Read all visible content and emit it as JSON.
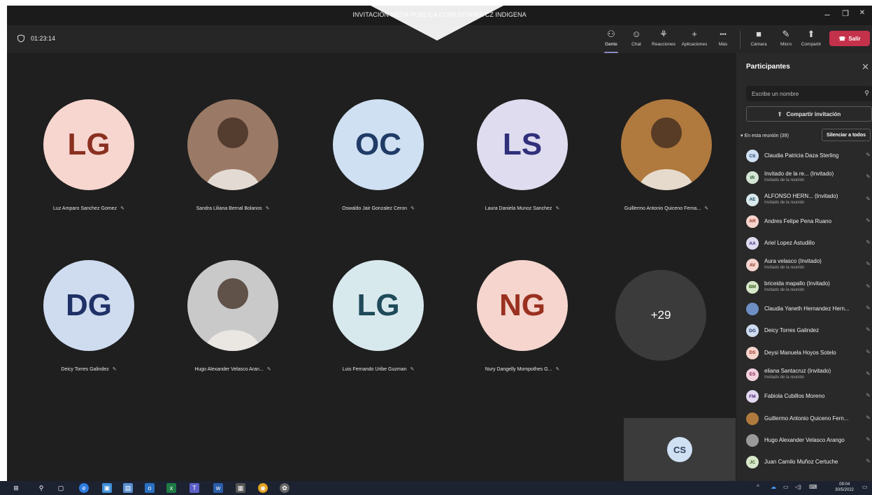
{
  "window": {
    "title": "INVITACIÓN MESA PUBLICA COMUNITARIA CZ INDIGENA",
    "minimize": "–",
    "maximize": "❐",
    "close": "✕"
  },
  "toolbar": {
    "timer": "01:23:14",
    "buttons": [
      {
        "label": "Gente",
        "icon": "people-icon",
        "glyph": "⚇"
      },
      {
        "label": "Chat",
        "icon": "chat-icon",
        "glyph": "☺"
      },
      {
        "label": "Reacciones",
        "icon": "reactions-icon",
        "glyph": "⚘"
      },
      {
        "label": "Aplicaciones",
        "icon": "apps-icon",
        "glyph": "+"
      },
      {
        "label": "Más",
        "icon": "more-icon",
        "glyph": "•••"
      },
      {
        "label": "Cámara",
        "icon": "camera-off-icon",
        "glyph": "■"
      },
      {
        "label": "Micro",
        "icon": "mic-off-icon",
        "glyph": "✎"
      },
      {
        "label": "Compartir",
        "icon": "share-icon",
        "glyph": "⬆"
      }
    ],
    "leave_label": "Salir"
  },
  "stage": {
    "tiles": [
      {
        "initials": "LG",
        "name": "Luz Amparo Sanchez Gomez",
        "bg": "#f7d6cf",
        "fg": "#8a3020",
        "photo": false
      },
      {
        "initials": "",
        "name": "Sandra Liliana Bernal Bolanos",
        "bg": "#9a7a66",
        "fg": "#fff",
        "photo": true
      },
      {
        "initials": "OC",
        "name": "Oswaldo Jair Gonzalez Ceron",
        "bg": "#cfe0f3",
        "fg": "#1f3b66",
        "photo": false
      },
      {
        "initials": "LS",
        "name": "Laura Daniela Munoz Sanchez",
        "bg": "#dfdcf0",
        "fg": "#2f2f7a",
        "photo": false
      },
      {
        "initials": "",
        "name": "Guillermo Antonio Quiceno Ferna...",
        "bg": "#b0793e",
        "fg": "#fff",
        "photo": true
      },
      {
        "initials": "DG",
        "name": "Deicy Torres Galindez",
        "bg": "#cfdcf0",
        "fg": "#1f3166",
        "photo": false
      },
      {
        "initials": "",
        "name": "Hugo Alexander Velasco Aran...",
        "bg": "#c9c9c9",
        "fg": "#fff",
        "photo": true
      },
      {
        "initials": "LG",
        "name": "Luis Fernando Uribe Guzman",
        "bg": "#d8e9ee",
        "fg": "#1f4a59",
        "photo": false
      },
      {
        "initials": "NG",
        "name": "Nury Dangelly Mompothes G...",
        "bg": "#f5d5cd",
        "fg": "#9a3020",
        "photo": false
      }
    ],
    "overflow_count": "+29",
    "self_initials": "CS"
  },
  "panel": {
    "title": "Participantes",
    "search_placeholder": "Escribe un nombre",
    "share_invite": "Compartir invitación",
    "in_meeting": "En esta reunión (39)",
    "mute_all": "Silenciar a todos",
    "participants": [
      {
        "initials": "CS",
        "name": "Claudia Patricia Daza Sterling",
        "sub": "",
        "bg": "#cfe0f3",
        "fg": "#1f3b66"
      },
      {
        "initials": "IR",
        "name": "Invitado de la re... (Invitado)",
        "sub": "Invitado de la reunión",
        "bg": "#d3e6d4",
        "fg": "#2d5a31"
      },
      {
        "initials": "AE",
        "name": "ALFONSO HERN... (Invitado)",
        "sub": "Invitado de la reunión",
        "bg": "#d8e9ee",
        "fg": "#1f4a59"
      },
      {
        "initials": "AR",
        "name": "Andres Felipe Pena Ruano",
        "sub": "",
        "bg": "#f5d5cd",
        "fg": "#9a3020"
      },
      {
        "initials": "AA",
        "name": "Ariel Lopez Astudillo",
        "sub": "",
        "bg": "#dfdcf0",
        "fg": "#2f2f7a"
      },
      {
        "initials": "AV",
        "name": "Aura velasco (Invitado)",
        "sub": "Invitado de la reunión",
        "bg": "#f7d6cf",
        "fg": "#8a3020"
      },
      {
        "initials": "BM",
        "name": "briceida mapallo (Invitado)",
        "sub": "Invitado de la reunión",
        "bg": "#d6e8c9",
        "fg": "#3d5a1f"
      },
      {
        "initials": "",
        "name": "Claudia Yaneth Hernandez Hern...",
        "sub": "",
        "bg": "#6d8fc4",
        "fg": "#fff"
      },
      {
        "initials": "DG",
        "name": "Deicy Torres Galindez",
        "sub": "",
        "bg": "#cfdcf0",
        "fg": "#1f3166"
      },
      {
        "initials": "DS",
        "name": "Deysi Manuela Hoyos Sotelo",
        "sub": "",
        "bg": "#f5d5cd",
        "fg": "#9a3020"
      },
      {
        "initials": "ES",
        "name": "eliana Santacruz (Invitado)",
        "sub": "Invitado de la reunión",
        "bg": "#f3d2de",
        "fg": "#8a2050"
      },
      {
        "initials": "FM",
        "name": "Fabiola Cubillos Moreno",
        "sub": "",
        "bg": "#e3d8f0",
        "fg": "#4a2a7a"
      },
      {
        "initials": "",
        "name": "Guillermo Antonio Quiceno Fern...",
        "sub": "",
        "bg": "#b0793e",
        "fg": "#fff"
      },
      {
        "initials": "",
        "name": "Hugo Alexander Velasco Arango",
        "sub": "",
        "bg": "#9a9a9a",
        "fg": "#fff"
      },
      {
        "initials": "JC",
        "name": "Juan Camilo Muñoz Certuche",
        "sub": "",
        "bg": "#d6e8c9",
        "fg": "#3d5a1f"
      }
    ]
  },
  "taskbar": {
    "time": "09:04",
    "date": "30/5/2022"
  }
}
